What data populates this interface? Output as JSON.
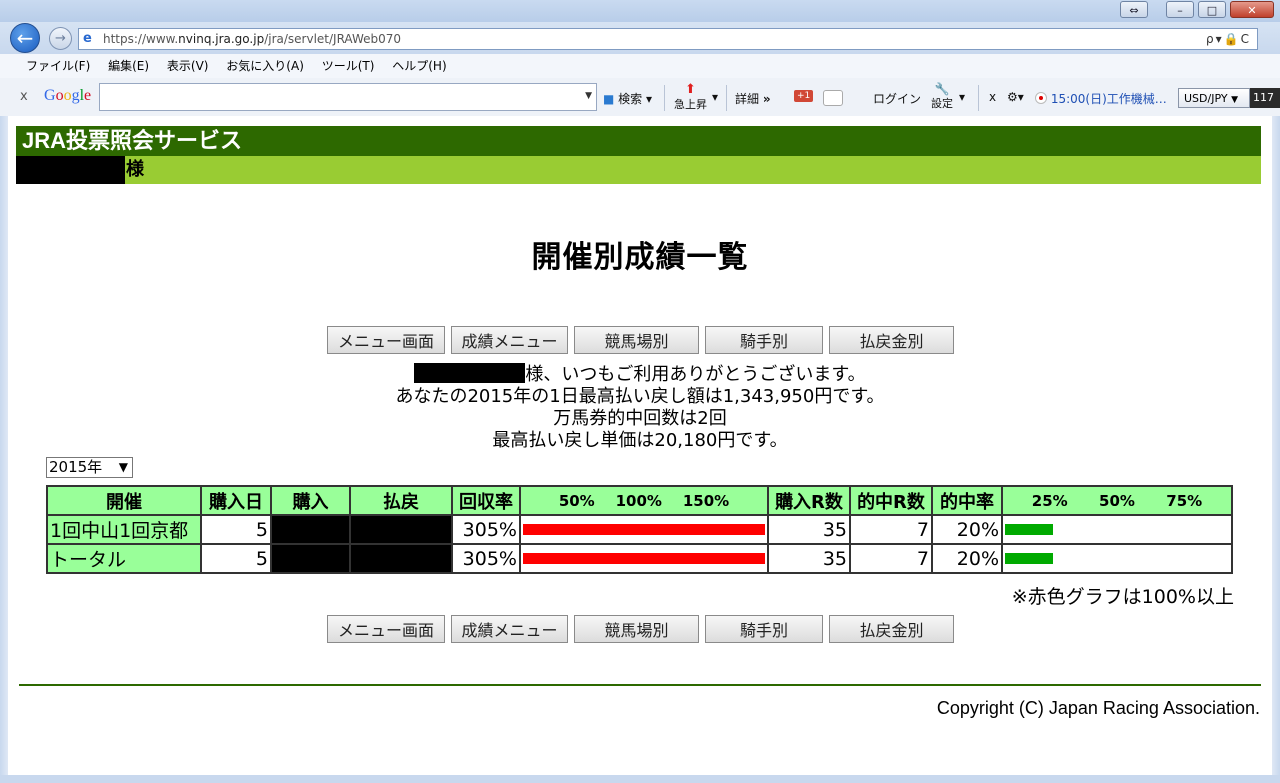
{
  "browser": {
    "url_prefix": "https://www.",
    "url_domain": "nvinq.jra.go.jp",
    "url_path": "/jra/servlet/JRAWeb070",
    "address_tools": "ρ▾🔒C",
    "menu": [
      "ファイル(F)",
      "編集(E)",
      "表示(V)",
      "お気に入り(A)",
      "ツール(T)",
      "ヘルプ(H)"
    ],
    "toolbar": {
      "search_label": "検索",
      "rising_label": "急上昇",
      "details_label": "詳細",
      "gplus_label": "+1",
      "login_label": "ログイン",
      "settings_label": "設定",
      "news_text": "15:00(日)工作機械…",
      "currency_label": "USD/JPY",
      "currency_rate": "117"
    }
  },
  "page": {
    "service_title": "JRA投票照会サービス",
    "sama": "様",
    "title": "開催別成績一覧",
    "nav_buttons": [
      "メニュー画面",
      "成績メニュー",
      "競馬場別",
      "騎手別",
      "払戻金別"
    ],
    "message_line1": "様、いつもご利用ありがとうございます。",
    "message_line2": "あなたの2015年の1日最高払い戻し額は1,343,950円です。",
    "message_line3": "万馬券的中回数は2回",
    "message_line4": "最高払い戻し単価は20,180円です。",
    "year_selected": "2015年",
    "table": {
      "headers": [
        "開催",
        "購入日",
        "購入",
        "払戻",
        "回収率",
        "購入R数",
        "的中R数",
        "的中率"
      ],
      "rate_scale": [
        "50%",
        "100%",
        "150%"
      ],
      "hit_scale": [
        "25%",
        "50%",
        "75%"
      ],
      "rows": [
        {
          "name": "1回中山1回京都",
          "days": "5",
          "return_rate": "305%",
          "return_rate_value": 305,
          "races": "35",
          "hits": "7",
          "hit_rate": "20%",
          "hit_rate_value": 20
        },
        {
          "name": "トータル",
          "days": "5",
          "return_rate": "305%",
          "return_rate_value": 305,
          "races": "35",
          "hits": "7",
          "hit_rate": "20%",
          "hit_rate_value": 20
        }
      ]
    },
    "note": "※赤色グラフは100%以上",
    "copyright": "Copyright (C) Japan Racing Association."
  },
  "colors": {
    "header_dark_green": "#2d6900",
    "header_light_green": "#99cc33",
    "table_header_green": "#99ff99",
    "bar_red": "#ff0000",
    "bar_green": "#00aa00"
  }
}
